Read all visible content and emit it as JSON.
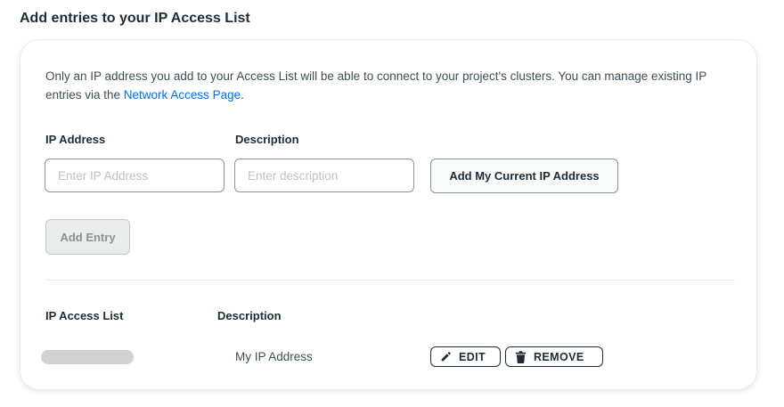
{
  "page": {
    "title": "Add entries to your IP Access List"
  },
  "intro": {
    "text": "Only an IP address you add to your Access List will be able to connect to your project's clusters. You can manage existing IP entries via the ",
    "link_text": "Network Access Page",
    "suffix": "."
  },
  "form": {
    "ip_label": "IP Address",
    "ip_placeholder": "Enter IP Address",
    "ip_value": "",
    "desc_label": "Description",
    "desc_placeholder": "Enter description",
    "desc_value": "",
    "current_ip_button": "Add My Current IP Address",
    "add_entry_button": "Add Entry"
  },
  "access_list": {
    "col_ip": "IP Access List",
    "col_desc": "Description",
    "rows": [
      {
        "ip": "",
        "description": "My IP Address",
        "edit_label": "EDIT",
        "remove_label": "REMOVE"
      }
    ]
  },
  "icons": {
    "edit": "pencil-icon",
    "remove": "trash-icon"
  },
  "colors": {
    "link": "#016bf8",
    "text": "#1c2d38",
    "border": "#889397"
  }
}
